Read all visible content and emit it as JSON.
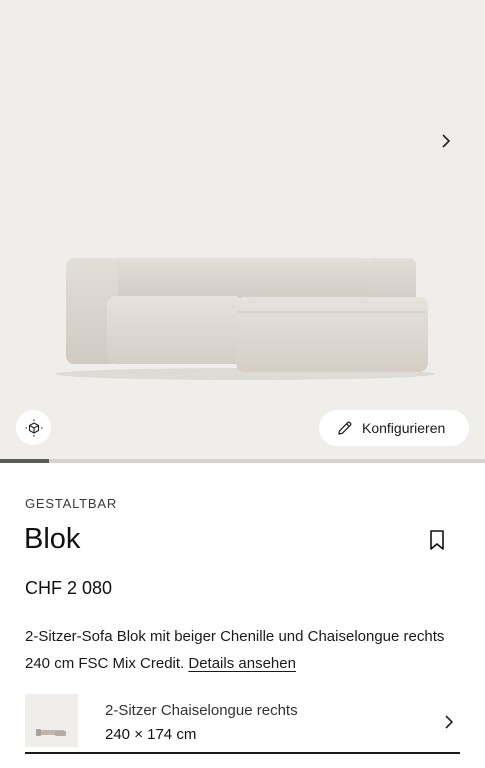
{
  "gallery": {
    "configure_label": "Konfigurieren",
    "progress_fraction": 0.1,
    "next_icon": "chevron-right-icon",
    "ar_icon": "cube-ar-icon",
    "edit_icon": "pencil-icon"
  },
  "product": {
    "eyebrow": "GESTALTBAR",
    "title": "Blok",
    "price": "CHF 2 080",
    "description": "2-Sitzer-Sofa Blok mit beiger Chenille und Chaiselongue rechts 240 cm FSC Mix Credit.",
    "details_link": "Details ansehen"
  },
  "variant": {
    "name": "2-Sitzer Chaiselongue rechts",
    "dimensions": "240 × 174 cm"
  },
  "colors": {
    "hero_bg": "#efeeeb",
    "sofa": "#dcd8d1",
    "text": "#1a1a1a"
  }
}
